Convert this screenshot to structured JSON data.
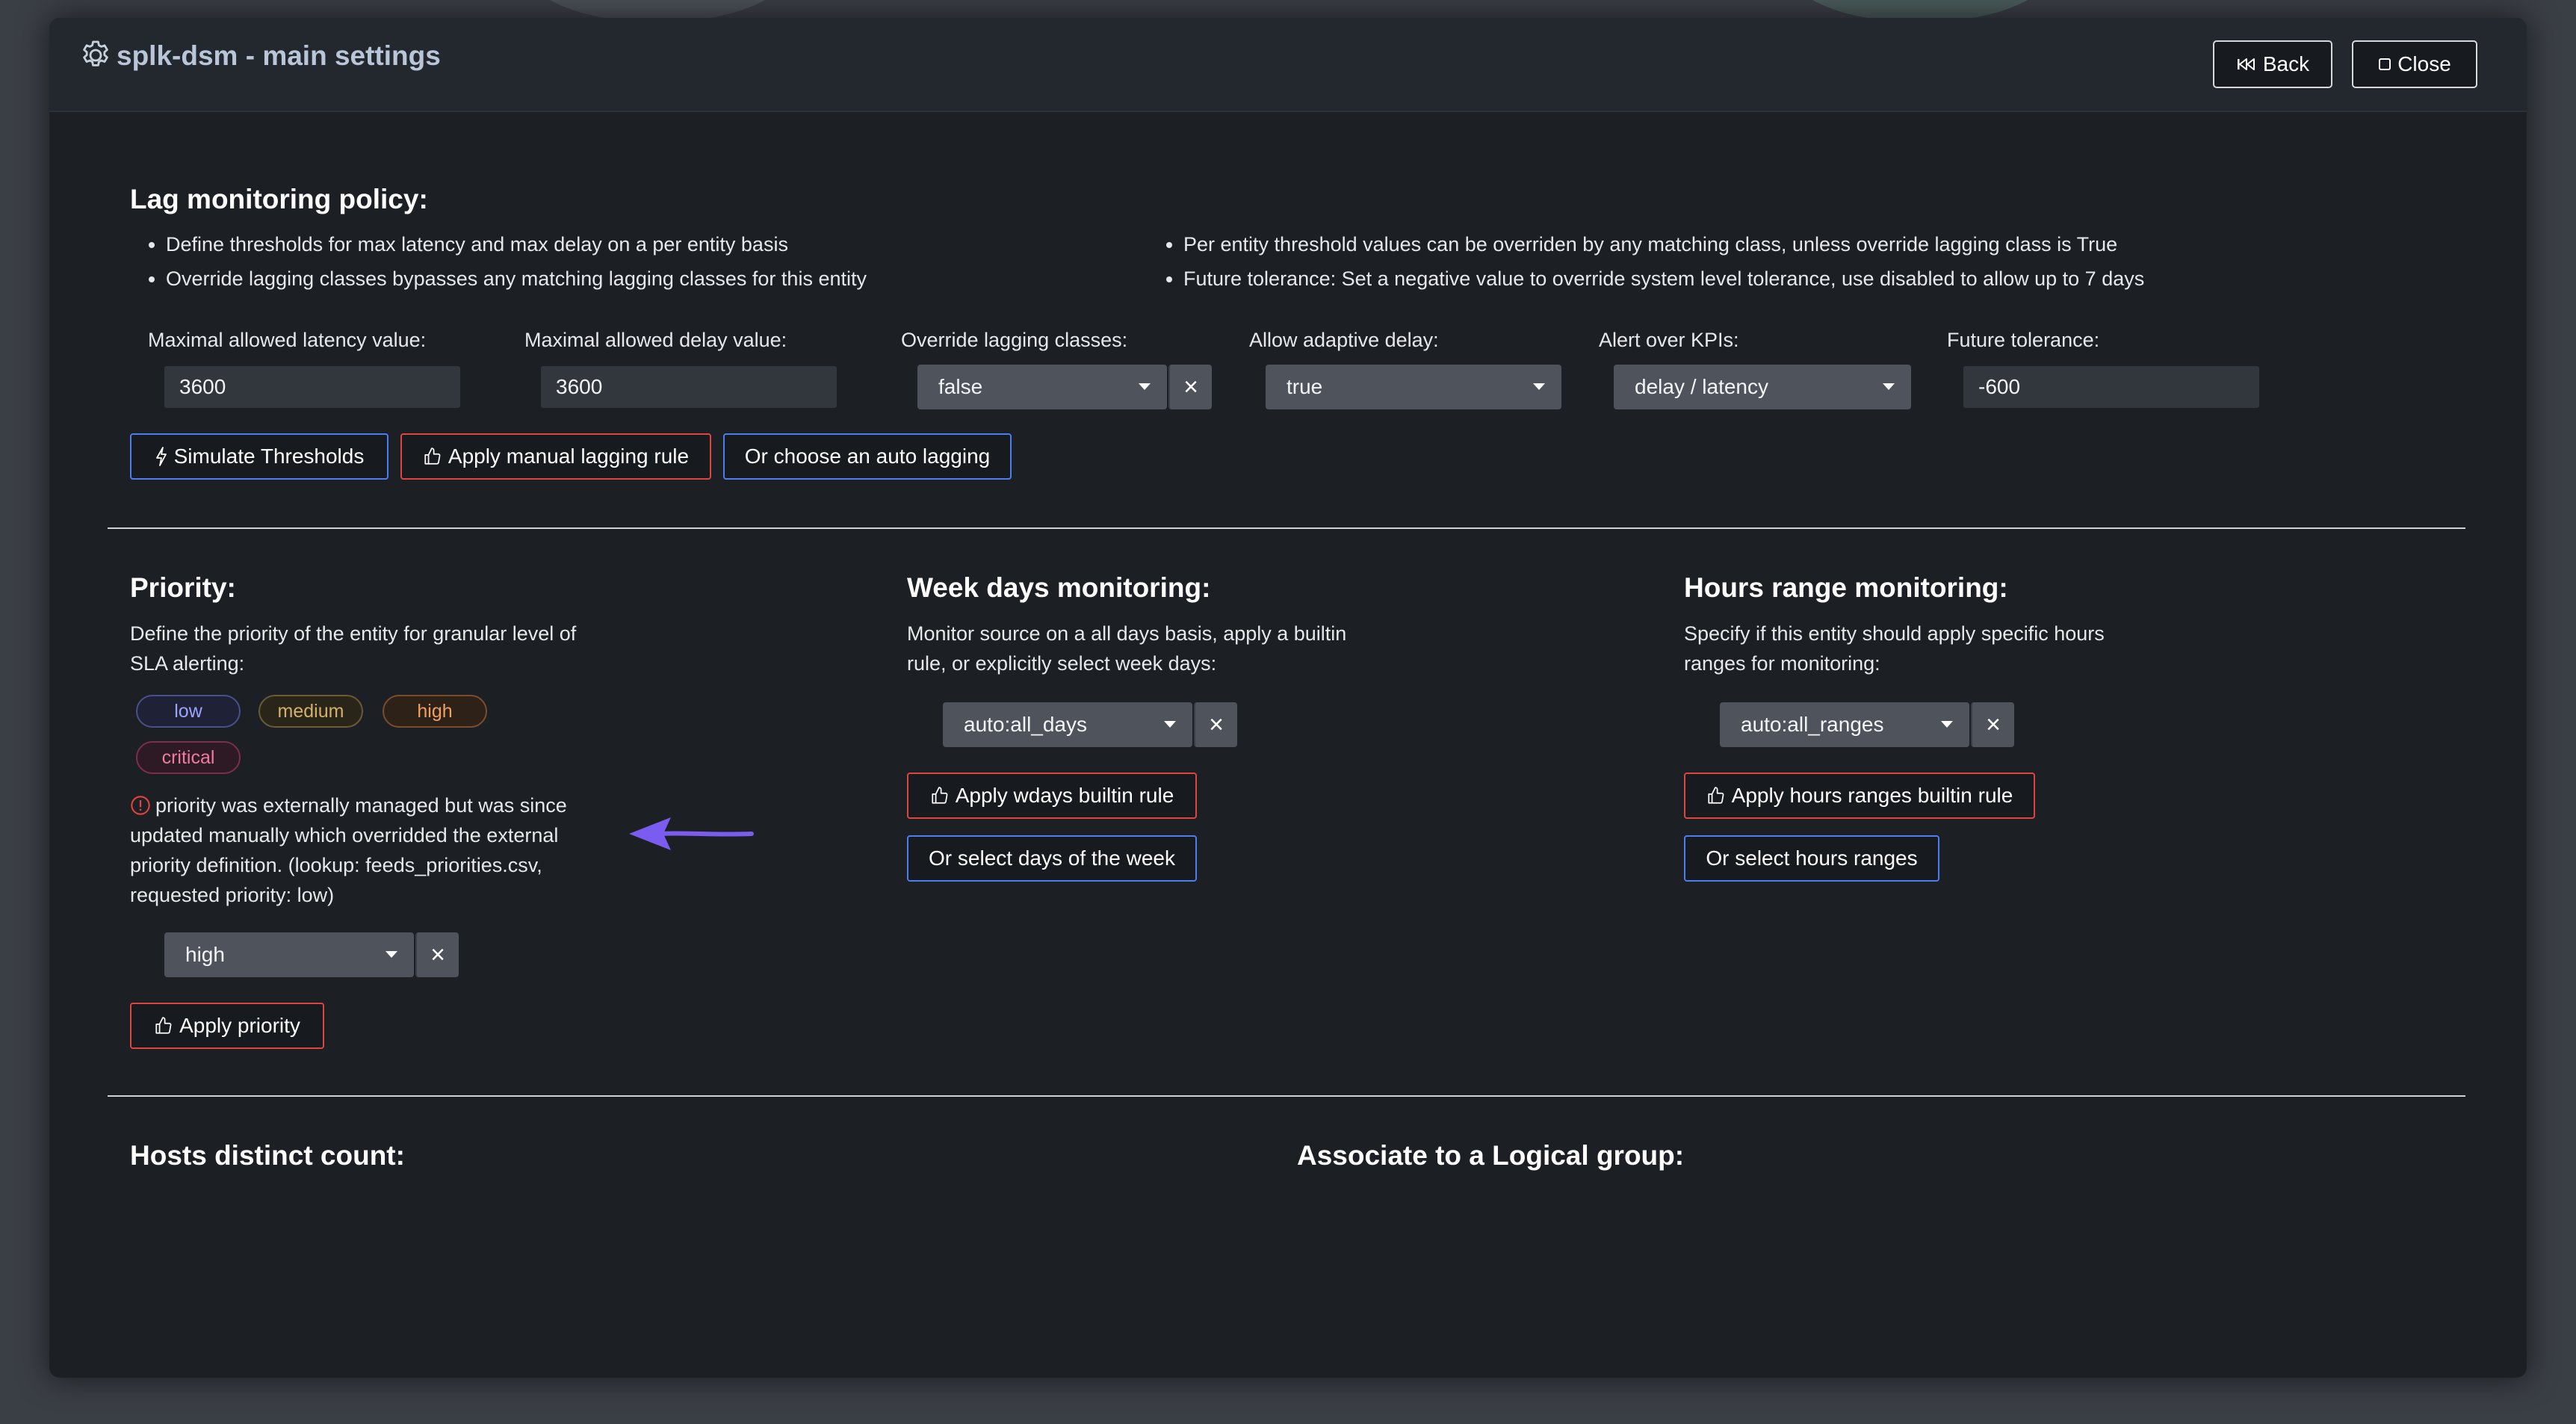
{
  "header": {
    "title": "splk-dsm - main settings",
    "back_label": "Back",
    "close_label": "Close"
  },
  "lag": {
    "title": "Lag monitoring policy:",
    "bullets_left": [
      "Define thresholds for max latency and max delay on a per entity basis",
      "Override lagging classes bypasses any matching lagging classes for this entity"
    ],
    "bullets_right": [
      "Per entity threshold values can be overriden by any matching class, unless override lagging class is True",
      "Future tolerance: Set a negative value to override system level tolerance, use disabled to allow up to 7 days"
    ],
    "fields": {
      "latency_label": "Maximal allowed latency value:",
      "latency_value": "3600",
      "delay_label": "Maximal allowed delay value:",
      "delay_value": "3600",
      "override_label": "Override lagging classes:",
      "override_value": "false",
      "adaptive_label": "Allow adaptive delay:",
      "adaptive_value": "true",
      "kpis_label": "Alert over KPIs:",
      "kpis_value": "delay / latency",
      "future_label": "Future tolerance:",
      "future_value": "-600"
    },
    "buttons": {
      "simulate": "Simulate Thresholds",
      "manual": "Apply manual lagging rule",
      "auto": "Or choose an auto lagging"
    }
  },
  "priority": {
    "title": "Priority:",
    "desc": "Define the priority of the entity for granular level of SLA alerting:",
    "badges": [
      "low",
      "medium",
      "high",
      "critical"
    ],
    "warning": "priority was externally managed but was since updated manually which overridded the external priority definition. (lookup: feeds_priorities.csv, requested priority: low)",
    "select_value": "high",
    "apply_label": "Apply priority"
  },
  "weekdays": {
    "title": "Week days monitoring:",
    "desc": "Monitor source on a all days basis, apply a builtin rule, or explicitly select week days:",
    "select_value": "auto:all_days",
    "apply_label": "Apply wdays builtin rule",
    "select_days_label": "Or select days of the week"
  },
  "hours": {
    "title": "Hours range monitoring:",
    "desc": "Specify if this entity should apply specific hours ranges for monitoring:",
    "select_value": "auto:all_ranges",
    "apply_label": "Apply hours ranges builtin rule",
    "select_ranges_label": "Or select hours ranges"
  },
  "hosts": {
    "title": "Hosts distinct count:"
  },
  "logical": {
    "title": "Associate to a Logical group:"
  },
  "colors": {
    "accent_blue": "#4a7ef0",
    "accent_red": "#e0443e",
    "arrow": "#7b5cf0"
  }
}
